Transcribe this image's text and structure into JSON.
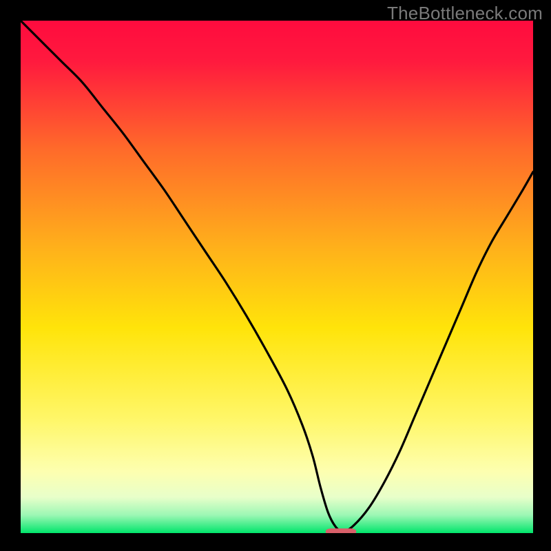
{
  "watermark": "TheBottleneck.com",
  "chart_data": {
    "type": "line",
    "title": "",
    "xlabel": "",
    "ylabel": "",
    "xlim": [
      0,
      100
    ],
    "ylim": [
      0,
      100
    ],
    "gradient_stops": [
      {
        "offset": 0.0,
        "color": "#ff0b3e"
      },
      {
        "offset": 0.08,
        "color": "#ff1a3e"
      },
      {
        "offset": 0.25,
        "color": "#ff6a2a"
      },
      {
        "offset": 0.45,
        "color": "#ffb31a"
      },
      {
        "offset": 0.6,
        "color": "#ffe40a"
      },
      {
        "offset": 0.78,
        "color": "#fff76a"
      },
      {
        "offset": 0.88,
        "color": "#fdffb0"
      },
      {
        "offset": 0.93,
        "color": "#e8ffca"
      },
      {
        "offset": 0.965,
        "color": "#9cf7b4"
      },
      {
        "offset": 1.0,
        "color": "#00e56b"
      }
    ],
    "series": [
      {
        "name": "bottleneck-curve",
        "x": [
          0,
          2,
          5,
          8,
          12,
          16,
          20,
          24,
          28,
          32,
          36,
          40,
          44,
          48,
          52,
          55,
          57,
          58.5,
          60,
          61.5,
          63,
          65,
          68,
          71,
          74,
          77,
          80,
          83,
          86,
          89,
          92,
          95,
          98,
          100
        ],
        "values": [
          100,
          98,
          95,
          92,
          88,
          83,
          78,
          72.5,
          67,
          61,
          55,
          49,
          42.5,
          35.5,
          28,
          21,
          15,
          9,
          4,
          1.2,
          0.3,
          1.5,
          5,
          10,
          16,
          23,
          30,
          37,
          44,
          51,
          57,
          62,
          67,
          70.5
        ]
      }
    ],
    "marker": {
      "name": "bottleneck-marker",
      "x": 62.5,
      "y": 0.3,
      "width": 6,
      "height": 1.2,
      "rx": 1.0,
      "color": "#d9606a"
    }
  }
}
